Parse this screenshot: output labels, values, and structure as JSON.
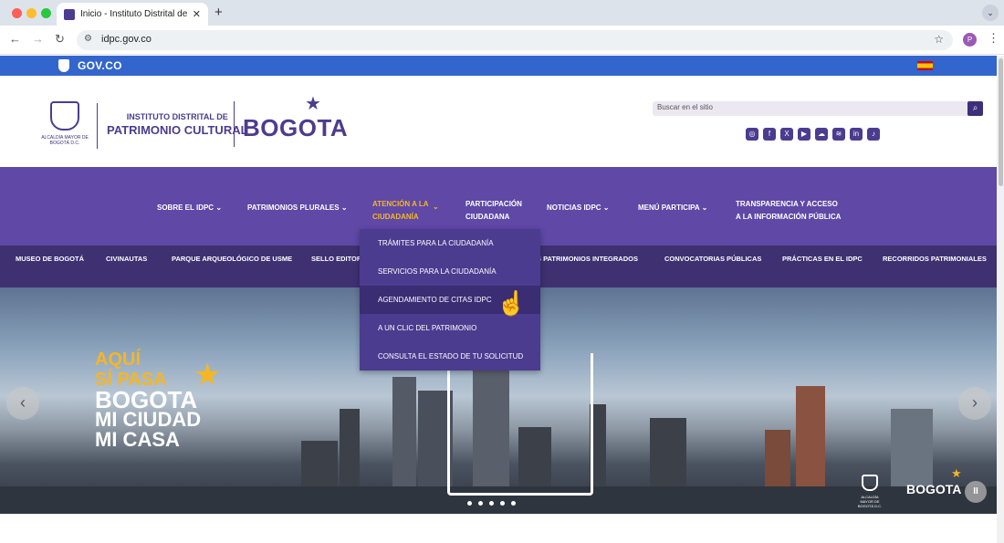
{
  "browser": {
    "tab_title": "Inicio - Instituto Distrital de P",
    "tab_close": "✕",
    "new_tab": "+",
    "url": "idpc.gov.co",
    "profile_initial": "P"
  },
  "govbar": {
    "label": "GOV.CO"
  },
  "header": {
    "escudo_text": "ALCALDÍA MAYOR DE BOGOTÁ D.C.",
    "institute_line1": "INSTITUTO DISTRITAL DE",
    "institute_line2": "PATRIMONIO CULTURAL",
    "bogota": "BOGOTA",
    "search_placeholder": "Buscar en el sitio",
    "socials": [
      "instagram-icon",
      "facebook-icon",
      "x-icon",
      "youtube-icon",
      "soundcloud-icon",
      "spotify-icon",
      "linkedin-icon",
      "tiktok-icon"
    ]
  },
  "nav": {
    "sobre": "SOBRE EL IDPC",
    "patrimonios": "PATRIMONIOS PLURALES",
    "atencion_l1": "ATENCIÓN A LA",
    "atencion_l2": "CIUDADANÍA",
    "participacion_l1": "PARTICIPACIÓN",
    "participacion_l2": "CIUDADANA",
    "noticias": "NOTICIAS IDPC",
    "menu_participa": "MENÚ PARTICIPA",
    "transparencia_l1": "TRANSPARENCIA Y ACCESO",
    "transparencia_l2": "A LA INFORMACIÓN PÚBLICA",
    "chevron": "⌄"
  },
  "subnav": {
    "museo": "MUSEO DE BOGOTÁ",
    "civinautas": "CIVINAUTAS",
    "parque": "PARQUE ARQUEOLÓGICO DE USME",
    "sello": "SELLO EDITORI",
    "patrimonios_integrados": "S PATRIMONIOS INTEGRADOS",
    "convocatorias": "CONVOCATORIAS PÚBLICAS",
    "practicas": "PRÁCTICAS EN EL IDPC",
    "recorridos": "RECORRIDOS PATRIMONIALES"
  },
  "dropdown": {
    "items": [
      "TRÁMITES PARA LA CIUDADANÍA",
      "SERVICIOS PARA LA CIUDADANÍA",
      "AGENDAMIENTO DE CITAS IDPC",
      "A UN CLIC DEL PATRIMONIO",
      "CONSULTA EL ESTADO DE TU SOLICITUD"
    ]
  },
  "hero": {
    "line1": "AQUÍ",
    "line2": "SÍ PASA",
    "line3": "BOGOTA",
    "line4": "MI CIUDAD",
    "line5": "MI CASA",
    "prev": "‹",
    "next": "›",
    "logo_escudo_text": "ALCALDÍA MAYOR DE BOGOTÁ D.C.",
    "logo_bogota": "BOGOTA",
    "pause": "II"
  }
}
